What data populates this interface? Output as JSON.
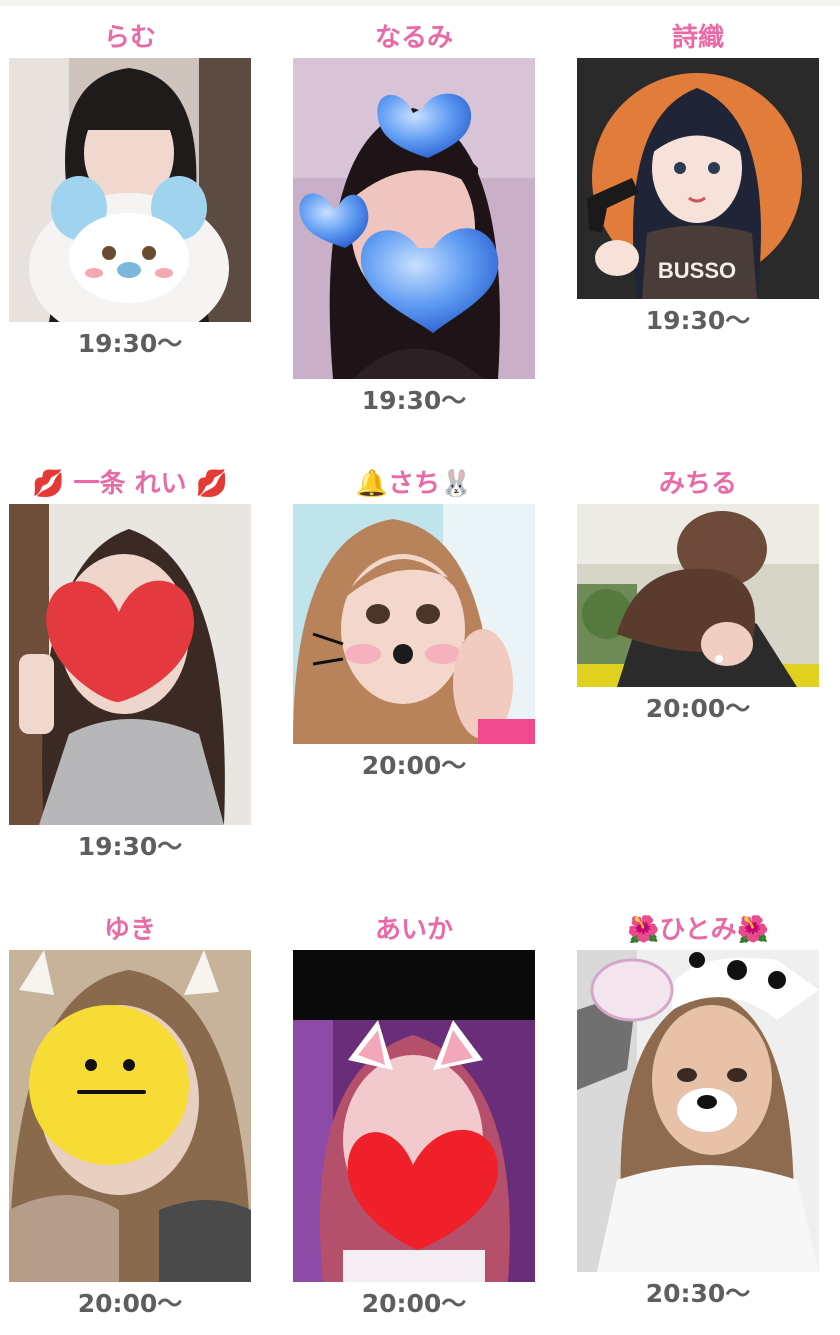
{
  "cast": [
    {
      "name": "らむ",
      "time": "19:30〜"
    },
    {
      "name": "なるみ",
      "time": "19:30〜"
    },
    {
      "name": "詩織",
      "time": "19:30〜",
      "shirt_text": "BUSSO"
    },
    {
      "name": "💋 一条 れい 💋",
      "time": "19:30〜"
    },
    {
      "name": "🔔さち🐰",
      "time": "20:00〜"
    },
    {
      "name": "みちる",
      "time": "20:00〜"
    },
    {
      "name": "ゆき",
      "time": "20:00〜"
    },
    {
      "name": "あいか",
      "time": "20:00〜"
    },
    {
      "name": "🌺ひとみ🌺",
      "time": "20:30〜"
    }
  ],
  "colors": {
    "name": "#ea6aa6",
    "time": "#5e5e5e"
  }
}
